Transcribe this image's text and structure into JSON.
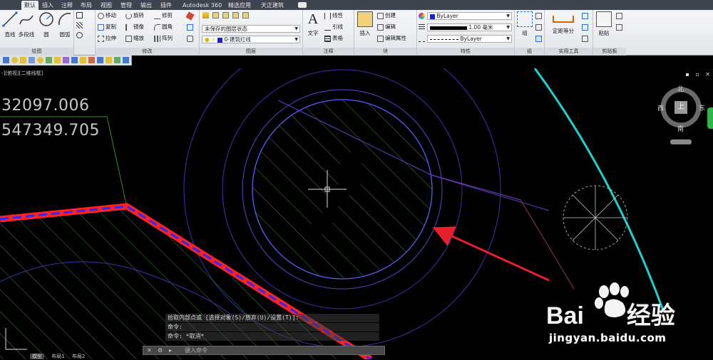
{
  "tabs": [
    "默认",
    "插入",
    "注释",
    "布局",
    "视图",
    "管理",
    "输出",
    "插件",
    "Autodesk 360",
    "精选应用",
    "天正建筑"
  ],
  "draw_panel": {
    "title": "绘图",
    "buttons": [
      "直线",
      "多段线",
      "圆",
      "圆弧"
    ]
  },
  "modify_panel": {
    "title": "修改",
    "buttons": [
      "移动",
      "旋转",
      "修剪",
      "复制",
      "镜像",
      "圆角",
      "拉伸",
      "缩放",
      "阵列"
    ]
  },
  "layers_panel": {
    "title": "图层",
    "layer_state": "未保存的图层状态",
    "current_layer": "0-建筑红线"
  },
  "annotation_panel": {
    "title": "注释",
    "text_button": "文字",
    "buttons": [
      "线性",
      "引线",
      "表格"
    ]
  },
  "block_panel": {
    "title": "块",
    "insert_button": "插入",
    "buttons": [
      "创建",
      "编辑",
      "编辑属性"
    ]
  },
  "properties_panel": {
    "title": "特性",
    "color": "ByLayer",
    "lineweight": "1.00 毫米",
    "linetype": "ByLayer"
  },
  "group_panel": {
    "title": "组",
    "group_button": "组"
  },
  "utilities_panel": {
    "title": "实用工具",
    "measure_button": "定距等分"
  },
  "clipboard_panel": {
    "title": "剪贴板",
    "paste_button": "粘贴"
  },
  "viewport": {
    "label": "-][俯视][二维线框]"
  },
  "coordinates": [
    "32097.006",
    "547349.705"
  ],
  "viewcube": {
    "north": "北",
    "south": "南",
    "east": "东",
    "west": "西",
    "top": "上"
  },
  "command": {
    "history": [
      "拾取内部点或 [选择对象(S)/放弃(U)/设置(T)]:",
      "命令:",
      "命令: *取消*"
    ],
    "placeholder": "键入命令"
  },
  "watermark": {
    "brand": "Bai",
    "brand_cn": "经验",
    "url": "jingyan.baidu.com"
  },
  "layout_tabs": [
    "模型",
    "布局1",
    "布局2"
  ],
  "colors": {
    "ribbon_bg": "#e8eaee",
    "boundary_red": "#ff2020",
    "dash_blue": "#2a2aff",
    "hatch_green": "#3f8a3f",
    "outline_purple": "#5a3fd0",
    "road_cyan": "#19d2d2",
    "arrow_red": "#e8202a"
  }
}
